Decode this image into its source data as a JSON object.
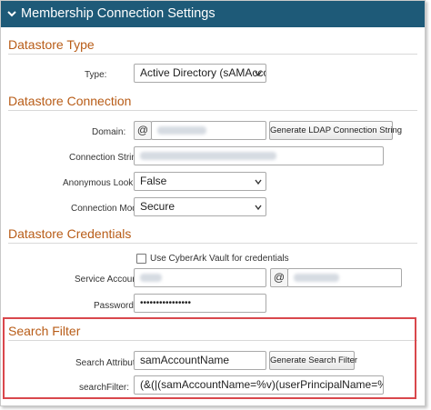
{
  "window": {
    "title": "Membership Connection Settings"
  },
  "sections": {
    "datastore_type": "Datastore Type",
    "datastore_connection": "Datastore Connection",
    "datastore_credentials": "Datastore Credentials",
    "search_filter": "Search Filter"
  },
  "fields": {
    "type_label": "Type:",
    "type_value": "Active Directory (sAMAccount",
    "domain_label": "Domain:",
    "domain_addon": "@",
    "generate_ldap_label": "Generate LDAP Connection String",
    "connection_string_label": "Connection String:",
    "anonymous_lookup_label": "Anonymous LookUp:",
    "anonymous_lookup_value": "False",
    "connection_mode_label": "Connection Mode:",
    "connection_mode_value": "Secure",
    "use_vault_label": "Use CyberArk Vault for credentials",
    "service_account_label": "Service Account:",
    "service_account_addon": "@",
    "password_label": "Password:",
    "password_value": "••••••••••••••••",
    "search_attribute_label": "Search Attribute:",
    "search_attribute_value": "samAccountName",
    "generate_search_filter_label": "Generate Search Filter",
    "search_filter_label": "searchFilter:",
    "search_filter_value": "(&(|(samAccountName=%v)(userPrincipalName=%v)))"
  },
  "colors": {
    "titlebar": "#1e5a78",
    "section_heading": "#b85c17",
    "highlight_border": "#d9474c"
  }
}
